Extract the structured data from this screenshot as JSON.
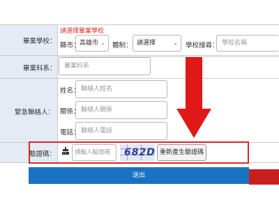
{
  "school": {
    "label": "畢業學校：",
    "hint": "請選擇畢業學校",
    "county_label": "縣市：",
    "county_value": "高雄市",
    "system_label": "體制：",
    "system_value": "請選擇",
    "search_label": "學校搜尋：",
    "search_placeholder": "學校名稱"
  },
  "department": {
    "label": "畢業科系：",
    "placeholder": "畢業科系"
  },
  "contact": {
    "label": "緊急聯絡人：",
    "name_label": "姓名：",
    "name_placeholder": "聯絡人姓名",
    "relation_label": "關係：",
    "relation_placeholder": "聯絡人關係",
    "phone_label": "電話：",
    "phone_placeholder": "聯絡人電話"
  },
  "captcha": {
    "label": "驗證碼：",
    "placeholder": "請輸入驗證碼",
    "code": "682D",
    "refresh_label": "重新產生驗證碼"
  },
  "submit_label": "送出",
  "colors": {
    "label_bg": "#e4ebf4",
    "hint_red": "#d9322c",
    "arrow_red": "#e01818",
    "submit_blue": "#1a72c2"
  },
  "icons": [
    "chevron-down-icon",
    "keyboard-icon",
    "down-arrow-annotation"
  ]
}
